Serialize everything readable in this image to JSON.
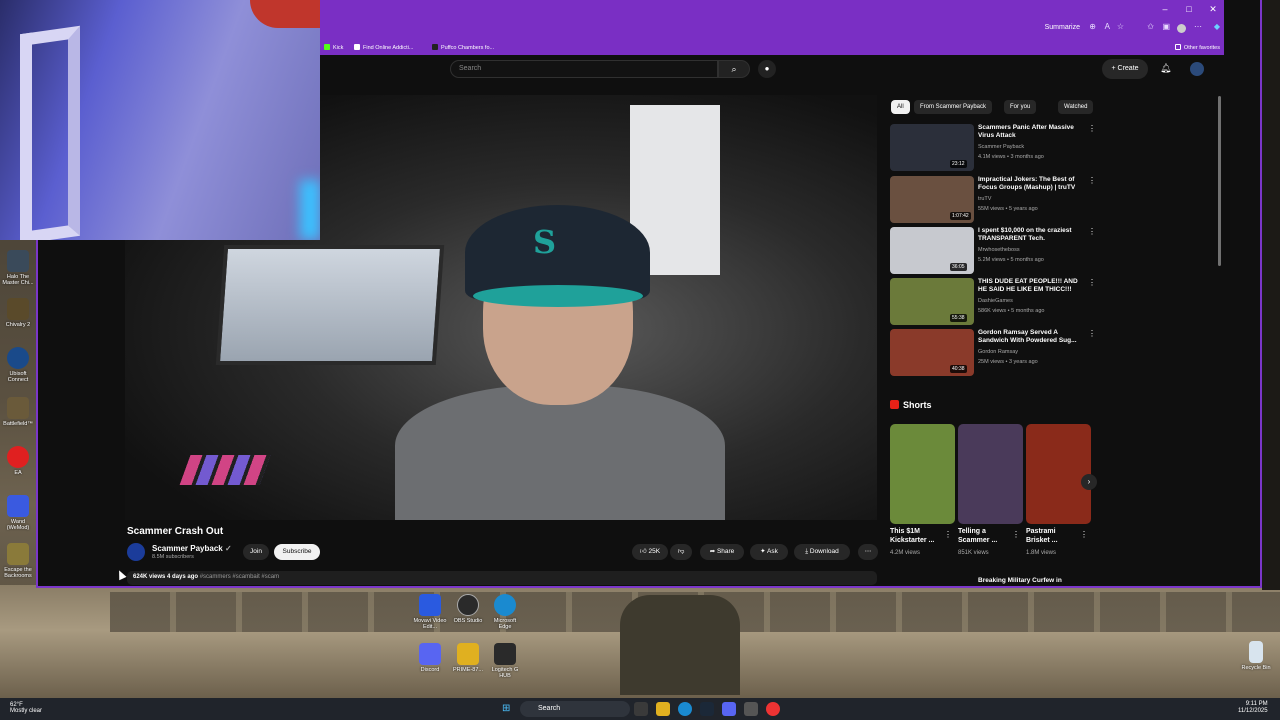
{
  "browser": {
    "summarize_label": "Summarize",
    "other_favorites": "Other favorites",
    "bookmarks": [
      {
        "label": "Kick",
        "color": "#53fc18"
      },
      {
        "label": "Find Online Addicti...",
        "color": "#ffffff"
      },
      {
        "label": "Puffco Chambers fo...",
        "color": "#222222"
      }
    ]
  },
  "youtube": {
    "search_placeholder": "Search",
    "create_label": "Create",
    "video_title": "Scammer Crash Out",
    "channel_name": "Scammer Payback",
    "channel_subs": "8.5M subscribers",
    "join_label": "Join",
    "subscribe_label": "Subscribe",
    "likes": "25K",
    "share_label": "Share",
    "ask_label": "Ask",
    "download_label": "Download",
    "views_date": "624K views  4 days ago",
    "hashtags": "#scammers #scambait #scam",
    "chips": [
      "All",
      "From Scammer Payback",
      "For you",
      "Watched"
    ],
    "recommendations": [
      {
        "title": "Scammers Panic After Massive Virus Attack",
        "channel": "Scammer Payback",
        "meta": "4.1M views • 3 months ago",
        "duration": "23:12",
        "thumb_color": "#2b2f3a"
      },
      {
        "title": "Impractical Jokers: The Best of Focus Groups (Mashup) | truTV",
        "channel": "truTV",
        "meta": "55M views • 5 years ago",
        "duration": "1:07:42",
        "thumb_color": "#6a5040"
      },
      {
        "title": "I spent $10,000 on the craziest TRANSPARENT Tech.",
        "channel": "Mrwhosetheboss",
        "meta": "5.2M views • 5 months ago",
        "duration": "36:05",
        "thumb_color": "#c7c9cf"
      },
      {
        "title": "THIS DUDE EAT PEOPLE!!! AND HE SAID HE LIKE EM THICC!!!",
        "channel": "DashieGames",
        "meta": "586K views • 5 months ago",
        "duration": "55:38",
        "thumb_color": "#6b7a3a"
      },
      {
        "title": "Gordon Ramsay Served A Sandwich With Powdered Sug...",
        "channel": "Gordon Ramsay",
        "meta": "25M views • 3 years ago",
        "duration": "40:38",
        "thumb_color": "#8a3a2a"
      }
    ],
    "shorts_heading": "Shorts",
    "shorts": [
      {
        "title": "This $1M Kickstarter ...",
        "views": "4.2M views",
        "color": "#6b8a3a"
      },
      {
        "title": "Telling a Scammer ...",
        "views": "851K views",
        "color": "#4a3a5a"
      },
      {
        "title": "Pastrami Brisket ...",
        "views": "1.8M views",
        "color": "#8a2a1a"
      }
    ],
    "next_rec_title": "Breaking Military Curfew in"
  },
  "desktop_icons": [
    {
      "label": "Halo The Master Chi...",
      "color": "#3a4a5a"
    },
    {
      "label": "Chivalry 2",
      "color": "#5a4a2a"
    },
    {
      "label": "Ubisoft Connect",
      "color": "#1a4a8a"
    },
    {
      "label": "Battlefield™",
      "color": "#6a5a3a"
    },
    {
      "label": "EA",
      "color": "#e02020"
    },
    {
      "label": "Wand (WeMod)",
      "color": "#3a5ae0"
    },
    {
      "label": "Escape the Backrooms",
      "color": "#8a7a3a"
    }
  ],
  "desktop_apps": [
    {
      "label": "Movavi Video Edit...",
      "color": "#2a5ae0"
    },
    {
      "label": "OBS Studio",
      "color": "#2a2a2a"
    },
    {
      "label": "Microsoft Edge",
      "color": "#1a8ad0"
    },
    {
      "label": "Discord",
      "color": "#5865f2"
    },
    {
      "label": "PRIME-87...",
      "color": "#e0b020"
    },
    {
      "label": "Logitech G HUB",
      "color": "#2a2a2a"
    }
  ],
  "recycle_bin": "Recycle Bin",
  "taskbar": {
    "temperature": "62°F",
    "weather": "Mostly clear",
    "search_label": "Search",
    "time": "9:11 PM",
    "date": "11/12/2025"
  }
}
